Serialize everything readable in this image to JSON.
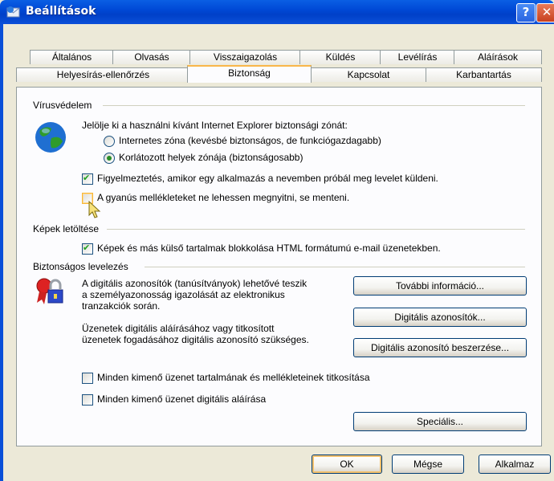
{
  "window": {
    "title": "Beállítások",
    "help_label": "?",
    "close_label": "✕"
  },
  "tabs_row1": [
    {
      "label": "Általános"
    },
    {
      "label": "Olvasás"
    },
    {
      "label": "Visszaigazolás"
    },
    {
      "label": "Küldés"
    },
    {
      "label": "Levélírás"
    },
    {
      "label": "Aláírások"
    }
  ],
  "tabs_row2": [
    {
      "label": "Helyesírás-ellenőrzés"
    },
    {
      "label": "Biztonság"
    },
    {
      "label": "Kapcsolat"
    },
    {
      "label": "Karbantartás"
    }
  ],
  "active_tab": "Biztonság",
  "virus": {
    "heading": "Vírusvédelem",
    "zone_prompt": "Jelölje ki a használni kívánt Internet Explorer biztonsági zónát:",
    "zone_internet": "Internetes zóna (kevésbé biztonságos, de funkciógazdagabb)",
    "zone_restricted": "Korlátozott helyek zónája (biztonságosabb)",
    "warn_label": "Figyelmeztetés, amikor egy alkalmazás a nevemben próbál meg levelet küldeni.",
    "block_attach_label": "A gyanús mellékleteket ne lehessen megnyitni, se menteni."
  },
  "images": {
    "heading": "Képek letöltése",
    "block_label": "Képek és más külső tartalmak blokkolása HTML formátumú e-mail üzenetekben."
  },
  "secure": {
    "heading": "Biztonságos levelezés",
    "desc1_line1": "A digitális azonosítók (tanúsítványok) lehetővé teszik",
    "desc1_line2": "a személyazonosság igazolását az elektronikus",
    "desc1_line3": "tranzakciók során.",
    "desc2_line1": "Üzenetek digitális aláírásához vagy titkosított",
    "desc2_line2": "üzenetek fogadásához digitális azonosító szükséges.",
    "more_info_button": "További információ...",
    "digital_ids_button": "Digitális azonosítók...",
    "get_id_button": "Digitális azonosító beszerzése...",
    "encrypt_label": "Minden kimenő üzenet tartalmának és mellékleteinek titkosítása",
    "sign_label": "Minden kimenő üzenet digitális aláírása",
    "advanced_button": "Speciális..."
  },
  "footer": {
    "ok": "OK",
    "cancel": "Mégse",
    "apply": "Alkalmaz"
  }
}
